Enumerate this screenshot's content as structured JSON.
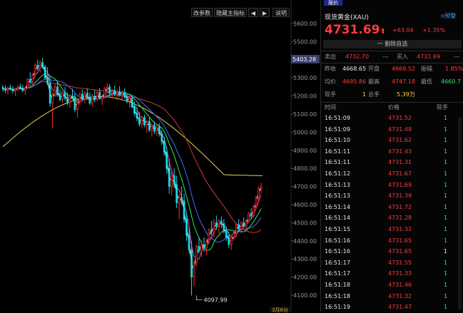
{
  "toolbar": {
    "params_label": "改参数",
    "hide_indicator_label": "隐藏主指标",
    "left_arrow": "◀",
    "right_arrow": "▶",
    "help_label": "说明"
  },
  "chart_data": {
    "type": "candlestick",
    "y_ticks": [
      "5600.00",
      "5500.00",
      "5400.00",
      "5300.00",
      "5200.00",
      "5100.00",
      "5000.00",
      "4900.00",
      "4800.00",
      "4700.00",
      "4600.00",
      "4500.00",
      "4400.00",
      "4300.00",
      "4200.00",
      "4100.00"
    ],
    "ylim": [
      4060,
      5640
    ],
    "current_price_label": "5403.28",
    "current_price": 5403.28,
    "low_annotation": "4097.99",
    "low_value": 4097.99,
    "bottom_label": "3月6分",
    "candles": [
      [
        5248,
        5262,
        5225,
        5240
      ],
      [
        5240,
        5258,
        5218,
        5232
      ],
      [
        5232,
        5250,
        5210,
        5245
      ],
      [
        5245,
        5262,
        5230,
        5238
      ],
      [
        5238,
        5255,
        5215,
        5228
      ],
      [
        5228,
        5246,
        5200,
        5238
      ],
      [
        5238,
        5260,
        5228,
        5250
      ],
      [
        5250,
        5270,
        5238,
        5243
      ],
      [
        5243,
        5262,
        5220,
        5230
      ],
      [
        5230,
        5250,
        5205,
        5245
      ],
      [
        5245,
        5300,
        5240,
        5292
      ],
      [
        5292,
        5330,
        5270,
        5278
      ],
      [
        5278,
        5325,
        5262,
        5318
      ],
      [
        5318,
        5380,
        5310,
        5370
      ],
      [
        5370,
        5400,
        5340,
        5352
      ],
      [
        5352,
        5395,
        5330,
        5385
      ],
      [
        5385,
        5410,
        5350,
        5360
      ],
      [
        5360,
        5372,
        5290,
        5300
      ],
      [
        5300,
        5360,
        5260,
        5270
      ],
      [
        5270,
        5310,
        5140,
        5160
      ],
      [
        5160,
        5220,
        5020,
        5205
      ],
      [
        5205,
        5265,
        5195,
        5250
      ],
      [
        5250,
        5280,
        5195,
        5205
      ],
      [
        5205,
        5235,
        5170,
        5180
      ],
      [
        5180,
        5228,
        5160,
        5220
      ],
      [
        5220,
        5250,
        5175,
        5190
      ],
      [
        5190,
        5220,
        5150,
        5160
      ],
      [
        5160,
        5210,
        5135,
        5200
      ],
      [
        5200,
        5240,
        5185,
        5195
      ],
      [
        5195,
        5215,
        5110,
        5125
      ],
      [
        5125,
        5175,
        5080,
        5165
      ],
      [
        5165,
        5220,
        5150,
        5210
      ],
      [
        5210,
        5235,
        5175,
        5185
      ],
      [
        5185,
        5225,
        5160,
        5215
      ],
      [
        5215,
        5240,
        5180,
        5190
      ],
      [
        5190,
        5218,
        5150,
        5160
      ],
      [
        5160,
        5210,
        5140,
        5200
      ],
      [
        5200,
        5235,
        5165,
        5180
      ],
      [
        5180,
        5230,
        5170,
        5220
      ],
      [
        5220,
        5245,
        5180,
        5185
      ],
      [
        5185,
        5210,
        5150,
        5195
      ],
      [
        5195,
        5250,
        5190,
        5240
      ],
      [
        5240,
        5272,
        5220,
        5250
      ],
      [
        5250,
        5265,
        5205,
        5215
      ],
      [
        5215,
        5240,
        5190,
        5230
      ],
      [
        5230,
        5258,
        5200,
        5210
      ],
      [
        5210,
        5240,
        5180,
        5225
      ],
      [
        5225,
        5255,
        5195,
        5205
      ],
      [
        5205,
        5230,
        5175,
        5218
      ],
      [
        5218,
        5242,
        5185,
        5195
      ],
      [
        5195,
        5215,
        5160,
        5170
      ],
      [
        5170,
        5200,
        5135,
        5188
      ],
      [
        5188,
        5202,
        5130,
        5140
      ],
      [
        5140,
        5170,
        5090,
        5105
      ],
      [
        5105,
        5138,
        5060,
        5078
      ],
      [
        5078,
        5110,
        5030,
        5045
      ],
      [
        5045,
        5090,
        5020,
        5082
      ],
      [
        5082,
        5098,
        5030,
        5040
      ],
      [
        5040,
        5068,
        4995,
        5060
      ],
      [
        5060,
        5080,
        5000,
        5012
      ],
      [
        5012,
        5050,
        4975,
        5040
      ],
      [
        5040,
        5060,
        4990,
        5005
      ],
      [
        5005,
        5040,
        4980,
        5030
      ],
      [
        5030,
        5050,
        4975,
        4990
      ],
      [
        4990,
        5010,
        4930,
        4950
      ],
      [
        4950,
        4975,
        4870,
        4890
      ],
      [
        4890,
        4920,
        4770,
        4800
      ],
      [
        4800,
        4850,
        4660,
        4700
      ],
      [
        4700,
        4780,
        4650,
        4760
      ],
      [
        4760,
        4800,
        4690,
        4710
      ],
      [
        4710,
        4760,
        4580,
        4610
      ],
      [
        4610,
        4660,
        4520,
        4640
      ],
      [
        4640,
        4700,
        4600,
        4620
      ],
      [
        4620,
        4660,
        4500,
        4520
      ],
      [
        4520,
        4560,
        4400,
        4430
      ],
      [
        4430,
        4480,
        4330,
        4350
      ],
      [
        4350,
        4400,
        4098,
        4200
      ],
      [
        4200,
        4300,
        4150,
        4280
      ],
      [
        4280,
        4380,
        4260,
        4370
      ],
      [
        4370,
        4420,
        4330,
        4345
      ],
      [
        4345,
        4400,
        4310,
        4380
      ],
      [
        4380,
        4420,
        4340,
        4360
      ],
      [
        4360,
        4410,
        4320,
        4395
      ],
      [
        4395,
        4470,
        4380,
        4460
      ],
      [
        4460,
        4510,
        4430,
        4450
      ],
      [
        4450,
        4520,
        4420,
        4500
      ],
      [
        4500,
        4540,
        4460,
        4480
      ],
      [
        4480,
        4520,
        4440,
        4510
      ],
      [
        4510,
        4535,
        4470,
        4495
      ],
      [
        4495,
        4520,
        4440,
        4455
      ],
      [
        4455,
        4480,
        4400,
        4420
      ],
      [
        4420,
        4450,
        4360,
        4380
      ],
      [
        4380,
        4430,
        4350,
        4420
      ],
      [
        4420,
        4460,
        4400,
        4440
      ],
      [
        4440,
        4500,
        4420,
        4490
      ],
      [
        4490,
        4520,
        4450,
        4465
      ],
      [
        4465,
        4510,
        4440,
        4500
      ],
      [
        4500,
        4530,
        4470,
        4480
      ],
      [
        4480,
        4520,
        4460,
        4510
      ],
      [
        4510,
        4560,
        4500,
        4550
      ],
      [
        4550,
        4580,
        4520,
        4540
      ],
      [
        4540,
        4600,
        4530,
        4590
      ],
      [
        4590,
        4650,
        4580,
        4640
      ],
      [
        4640,
        4700,
        4620,
        4690
      ],
      [
        4690,
        4720,
        4660,
        4700
      ]
    ]
  },
  "quote": {
    "tab_label": "报价",
    "name": "现货黄金(XAU)",
    "alert_label": "预警",
    "price": "4731.69",
    "arrow": "⬆",
    "change": "+63.04",
    "change_pct": "+1.35%",
    "watchlist_label": "一 删除自选"
  },
  "bidask": {
    "sell_label": "卖出",
    "sell_price": "4732.70",
    "sell_qty": "---",
    "buy_label": "买入",
    "buy_price": "4731.69",
    "buy_qty": "---"
  },
  "stats": {
    "prev_close_label": "昨收",
    "prev_close": "4668.65",
    "open_label": "开盘",
    "open": "4669.52",
    "amp_label": "振幅",
    "amp": "1.85%",
    "avg_label": "均价",
    "avg": "4695.86",
    "high_label": "最高",
    "high": "4747.18",
    "low_label": "最低",
    "low": "4660.7",
    "cur_vol_label": "现手",
    "cur_vol": "1",
    "total_vol_label": "总手",
    "total_vol": "5.39万"
  },
  "ticks": {
    "headers": [
      "时间",
      "价格",
      "现手"
    ],
    "rows": [
      {
        "time": "16:51:09",
        "price": "4731.52",
        "vol": "1",
        "vol_color": "green"
      },
      {
        "time": "16:51:09",
        "price": "4731.49",
        "vol": "1",
        "vol_color": "green"
      },
      {
        "time": "16:51:10",
        "price": "4731.62",
        "vol": "1",
        "vol_color": "green"
      },
      {
        "time": "16:51:11",
        "price": "4731.43",
        "vol": "1",
        "vol_color": "green"
      },
      {
        "time": "16:51:11",
        "price": "4731.31",
        "vol": "1",
        "vol_color": "green"
      },
      {
        "time": "16:51:12",
        "price": "4731.67",
        "vol": "1",
        "vol_color": "green"
      },
      {
        "time": "16:51:13",
        "price": "4731.69",
        "vol": "1",
        "vol_color": "green"
      },
      {
        "time": "16:51:13",
        "price": "4731.39",
        "vol": "1",
        "vol_color": "green"
      },
      {
        "time": "16:51:14",
        "price": "4731.72",
        "vol": "1",
        "vol_color": "green"
      },
      {
        "time": "16:51:14",
        "price": "4731.28",
        "vol": "1",
        "vol_color": "green"
      },
      {
        "time": "16:51:15",
        "price": "4731.32",
        "vol": "1",
        "vol_color": "green"
      },
      {
        "time": "16:51:16",
        "price": "4731.65",
        "vol": "1",
        "vol_color": "green"
      },
      {
        "time": "16:51:16",
        "price": "4731.65",
        "vol": "1",
        "vol_color": "white"
      },
      {
        "time": "16:51:17",
        "price": "4731.55",
        "vol": "1",
        "vol_color": "green"
      },
      {
        "time": "16:51:17",
        "price": "4731.33",
        "vol": "1",
        "vol_color": "green"
      },
      {
        "time": "16:51:18",
        "price": "4731.46",
        "vol": "1",
        "vol_color": "green"
      },
      {
        "time": "16:51:18",
        "price": "4731.32",
        "vol": "1",
        "vol_color": "green"
      },
      {
        "time": "16:51:19",
        "price": "4731.47",
        "vol": "1",
        "vol_color": "green"
      }
    ]
  },
  "colors": {
    "up": "#ff2b2b",
    "down": "#19d9e6",
    "ma_yellow": "#e8d44a",
    "ma_red": "#d23a3a",
    "ma_blue": "#4a68ff",
    "ma_green": "#2ee86a",
    "ma_white": "#ffffff",
    "ma_magenta": "#e84aa8"
  }
}
